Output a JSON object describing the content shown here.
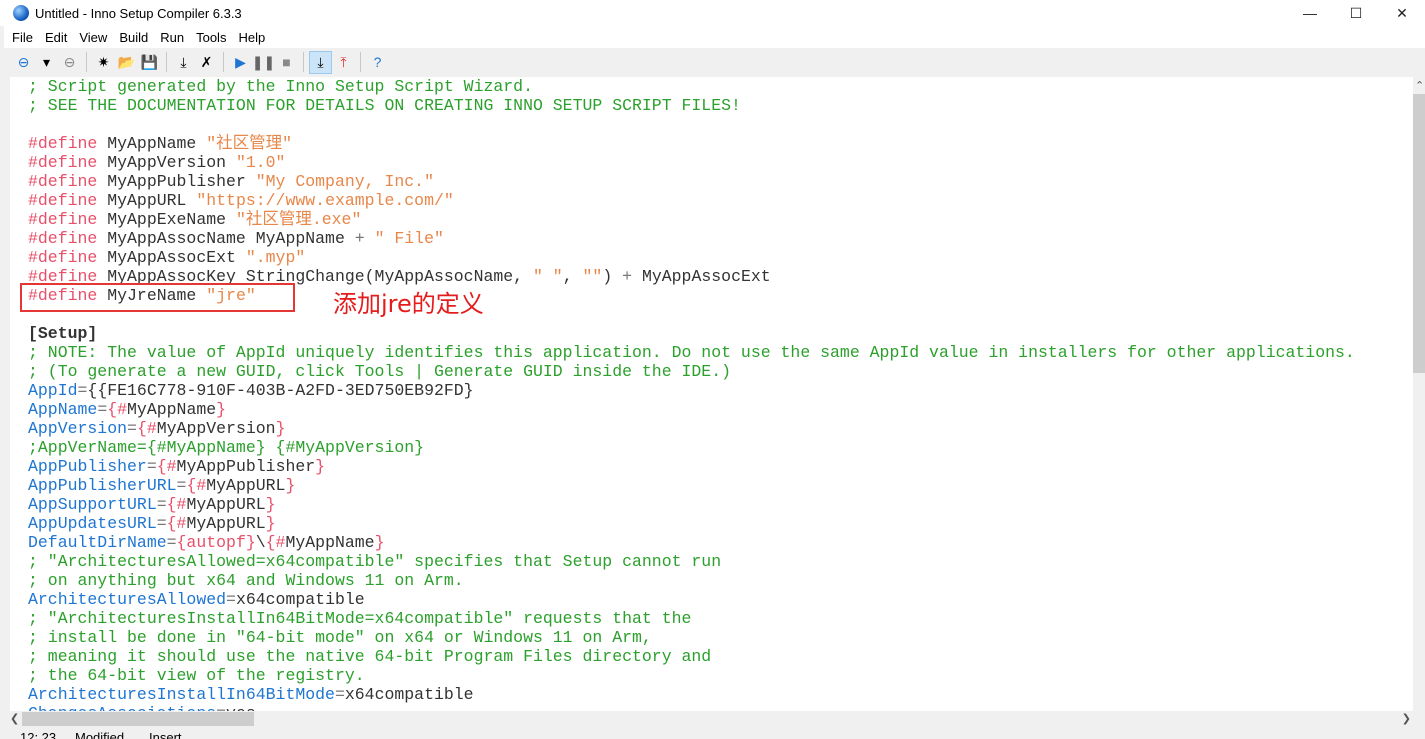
{
  "window": {
    "title": "Untitled - Inno Setup Compiler 6.3.3",
    "minimize": "—",
    "maximize": "☐",
    "close": "✕"
  },
  "menu": [
    "File",
    "Edit",
    "View",
    "Build",
    "Run",
    "Tools",
    "Help"
  ],
  "toolbar": [
    {
      "name": "back-icon",
      "glyph": "⊖"
    },
    {
      "name": "dropdown-icon",
      "glyph": "▾"
    },
    {
      "name": "forward-icon",
      "glyph": "⊖"
    },
    {
      "sep": true
    },
    {
      "name": "new-file-icon",
      "glyph": "✷"
    },
    {
      "name": "open-file-icon",
      "glyph": "📂"
    },
    {
      "name": "save-icon",
      "glyph": "💾"
    },
    {
      "sep": true
    },
    {
      "name": "compile-icon",
      "glyph": "⤓"
    },
    {
      "name": "stop-compile-icon",
      "glyph": "✗"
    },
    {
      "sep": true
    },
    {
      "name": "run-icon",
      "glyph": "▶"
    },
    {
      "name": "pause-icon",
      "glyph": "❚❚"
    },
    {
      "name": "stop-icon",
      "glyph": "■"
    },
    {
      "sep": true
    },
    {
      "name": "target-download-icon",
      "glyph": "⤓",
      "active": true
    },
    {
      "name": "target-upload-icon",
      "glyph": "⤒"
    },
    {
      "sep": true
    },
    {
      "name": "help-icon",
      "glyph": "?"
    }
  ],
  "code": [
    [
      [
        "c",
        "; Script generated by the Inno Setup Script Wizard."
      ]
    ],
    [
      [
        "c",
        "; SEE THE DOCUMENTATION FOR DETAILS ON CREATING INNO SETUP SCRIPT FILES!"
      ]
    ],
    [],
    [
      [
        "d",
        "#define"
      ],
      [
        "t",
        " MyAppName "
      ],
      [
        "s",
        "\"社区管理\""
      ]
    ],
    [
      [
        "d",
        "#define"
      ],
      [
        "t",
        " MyAppVersion "
      ],
      [
        "s",
        "\"1.0\""
      ]
    ],
    [
      [
        "d",
        "#define"
      ],
      [
        "t",
        " MyAppPublisher "
      ],
      [
        "s",
        "\"My Company, Inc.\""
      ]
    ],
    [
      [
        "d",
        "#define"
      ],
      [
        "t",
        " MyAppURL "
      ],
      [
        "s",
        "\"https://www.example.com/\""
      ]
    ],
    [
      [
        "d",
        "#define"
      ],
      [
        "t",
        " MyAppExeName "
      ],
      [
        "s",
        "\"社区管理.exe\""
      ]
    ],
    [
      [
        "d",
        "#define"
      ],
      [
        "t",
        " MyAppAssocName MyAppName "
      ],
      [
        "o",
        "+"
      ],
      [
        "t",
        " "
      ],
      [
        "s",
        "\" File\""
      ]
    ],
    [
      [
        "d",
        "#define"
      ],
      [
        "t",
        " MyAppAssocExt "
      ],
      [
        "s",
        "\".myp\""
      ]
    ],
    [
      [
        "d",
        "#define"
      ],
      [
        "t",
        " MyAppAssocKey StringChange(MyAppAssocName, "
      ],
      [
        "s",
        "\" \""
      ],
      [
        "t",
        ", "
      ],
      [
        "s",
        "\"\""
      ],
      [
        "t",
        ") "
      ],
      [
        "o",
        "+"
      ],
      [
        "t",
        " MyAppAssocExt"
      ]
    ],
    [
      [
        "d",
        "#define"
      ],
      [
        "t",
        " MyJreName "
      ],
      [
        "s",
        "\"jre\""
      ]
    ],
    [],
    [
      [
        "sec",
        "[Setup]"
      ]
    ],
    [
      [
        "c",
        "; NOTE: The value of AppId uniquely identifies this application. Do not use the same AppId value in installers for other applications."
      ]
    ],
    [
      [
        "c",
        "; (To generate a new GUID, click Tools | Generate GUID inside the IDE.)"
      ]
    ],
    [
      [
        "k",
        "AppId"
      ],
      [
        "o",
        "="
      ],
      [
        "t",
        "{{FE16C778-910F-403B-A2FD-3ED750EB92FD}"
      ]
    ],
    [
      [
        "k",
        "AppName"
      ],
      [
        "o",
        "="
      ],
      [
        "p",
        "{#"
      ],
      [
        "t",
        "MyAppName"
      ],
      [
        "p",
        "}"
      ]
    ],
    [
      [
        "k",
        "AppVersion"
      ],
      [
        "o",
        "="
      ],
      [
        "p",
        "{#"
      ],
      [
        "t",
        "MyAppVersion"
      ],
      [
        "p",
        "}"
      ]
    ],
    [
      [
        "c",
        ";AppVerName={#MyAppName} {#MyAppVersion}"
      ]
    ],
    [
      [
        "k",
        "AppPublisher"
      ],
      [
        "o",
        "="
      ],
      [
        "p",
        "{#"
      ],
      [
        "t",
        "MyAppPublisher"
      ],
      [
        "p",
        "}"
      ]
    ],
    [
      [
        "k",
        "AppPublisherURL"
      ],
      [
        "o",
        "="
      ],
      [
        "p",
        "{#"
      ],
      [
        "t",
        "MyAppURL"
      ],
      [
        "p",
        "}"
      ]
    ],
    [
      [
        "k",
        "AppSupportURL"
      ],
      [
        "o",
        "="
      ],
      [
        "p",
        "{#"
      ],
      [
        "t",
        "MyAppURL"
      ],
      [
        "p",
        "}"
      ]
    ],
    [
      [
        "k",
        "AppUpdatesURL"
      ],
      [
        "o",
        "="
      ],
      [
        "p",
        "{#"
      ],
      [
        "t",
        "MyAppURL"
      ],
      [
        "p",
        "}"
      ]
    ],
    [
      [
        "k",
        "DefaultDirName"
      ],
      [
        "o",
        "="
      ],
      [
        "p",
        "{autopf}"
      ],
      [
        "t",
        "\\"
      ],
      [
        "p",
        "{#"
      ],
      [
        "t",
        "MyAppName"
      ],
      [
        "p",
        "}"
      ]
    ],
    [
      [
        "c",
        "; \"ArchitecturesAllowed=x64compatible\" specifies that Setup cannot run"
      ]
    ],
    [
      [
        "c",
        "; on anything but x64 and Windows 11 on Arm."
      ]
    ],
    [
      [
        "k",
        "ArchitecturesAllowed"
      ],
      [
        "o",
        "="
      ],
      [
        "t",
        "x64compatible"
      ]
    ],
    [
      [
        "c",
        "; \"ArchitecturesInstallIn64BitMode=x64compatible\" requests that the"
      ]
    ],
    [
      [
        "c",
        "; install be done in \"64-bit mode\" on x64 or Windows 11 on Arm,"
      ]
    ],
    [
      [
        "c",
        "; meaning it should use the native 64-bit Program Files directory and"
      ]
    ],
    [
      [
        "c",
        "; the 64-bit view of the registry."
      ]
    ],
    [
      [
        "k",
        "ArchitecturesInstallIn64BitMode"
      ],
      [
        "o",
        "="
      ],
      [
        "t",
        "x64compatible"
      ]
    ],
    [
      [
        "k",
        "ChangesAssociations"
      ],
      [
        "o",
        "="
      ],
      [
        "t",
        "yes"
      ]
    ]
  ],
  "annotation": "添加jre的定义",
  "annotation_color": "#e51c1c",
  "status": {
    "position": "12: 23",
    "modified": "Modified",
    "mode": "Insert"
  }
}
